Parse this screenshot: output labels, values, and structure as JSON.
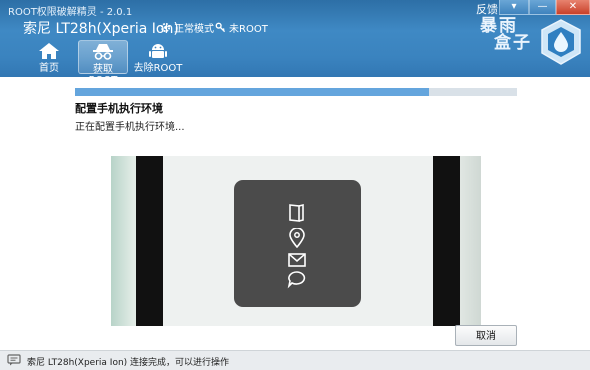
{
  "window": {
    "title": "ROOT权限破解精灵 - 2.0.1",
    "feedback_label": "反馈",
    "controls": {
      "menu": "▾",
      "minimize": "—",
      "close": "✕"
    }
  },
  "header": {
    "device_name": "索尼 LT28h(Xperia Ion)",
    "mode_status": "正常模式",
    "root_status": "未ROOT",
    "logo_text_line1": "暴雨",
    "logo_text_line2": "盒子"
  },
  "nav": [
    {
      "label": "首页",
      "icon": "home-icon"
    },
    {
      "label": "获取ROOT",
      "icon": "incognito-icon",
      "active": true
    },
    {
      "label": "去除ROOT",
      "icon": "android-icon"
    }
  ],
  "progress": {
    "fraction": 0.8,
    "step_title": "配置手机执行环境",
    "step_subtitle": "正在配置手机执行环境..."
  },
  "overlay_icons": [
    "book-icon",
    "location-pin-icon",
    "mail-icon",
    "chat-bubble-icon"
  ],
  "buttons": {
    "cancel": "取消"
  },
  "statusbar": {
    "text": "索尼 LT28h(Xperia Ion) 连接完成，可以进行操作"
  },
  "colors": {
    "header": "#3a83bf",
    "progress_fill": "#64a5dd",
    "progress_track": "#d9e1e8",
    "overlay": "#4b4b4b"
  }
}
